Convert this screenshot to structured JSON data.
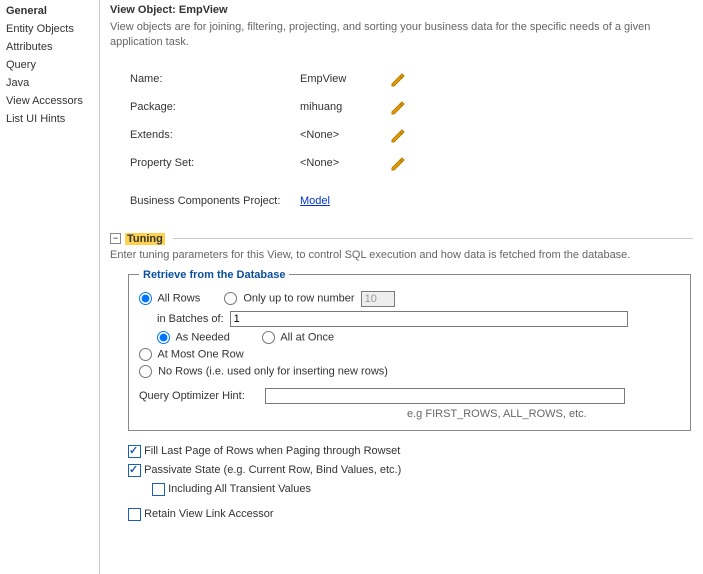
{
  "sidebar": {
    "items": [
      {
        "label": "General",
        "selected": true
      },
      {
        "label": "Entity Objects"
      },
      {
        "label": "Attributes"
      },
      {
        "label": "Query"
      },
      {
        "label": "Java"
      },
      {
        "label": "View Accessors"
      },
      {
        "label": "List UI Hints"
      }
    ]
  },
  "header": {
    "title": "View Object: EmpView",
    "description": "View objects are for joining, filtering, projecting, and sorting your business data for the specific needs of a given application task."
  },
  "props": {
    "name_label": "Name:",
    "name_value": "EmpView",
    "package_label": "Package:",
    "package_value": "mihuang",
    "extends_label": "Extends:",
    "extends_value": "<None>",
    "propset_label": "Property Set:",
    "propset_value": "<None>",
    "bcproj_label": "Business Components Project:",
    "bcproj_value": "Model"
  },
  "tuning": {
    "title": "Tuning",
    "desc": "Enter tuning parameters for this View, to control SQL execution and how data is fetched from the database.",
    "legend": "Retrieve from the Database",
    "all_rows": "All Rows",
    "only_upto": "Only up to row number",
    "only_upto_val": "10",
    "in_batches": "in Batches of:",
    "in_batches_val": "1",
    "as_needed": "As Needed",
    "all_at_once": "All at Once",
    "at_most_one": "At Most One Row",
    "no_rows": "No Rows (i.e. used only for inserting new rows)",
    "hint_label": "Query Optimizer Hint:",
    "hint_val": "",
    "hint_hint": "e.g FIRST_ROWS, ALL_ROWS, etc."
  },
  "options": {
    "fill_last": "Fill Last Page of Rows when Paging through Rowset",
    "passivate": "Passivate State (e.g. Current Row, Bind Values, etc.)",
    "incl_transient": "Including All Transient Values",
    "retain": "Retain View Link Accessor"
  }
}
